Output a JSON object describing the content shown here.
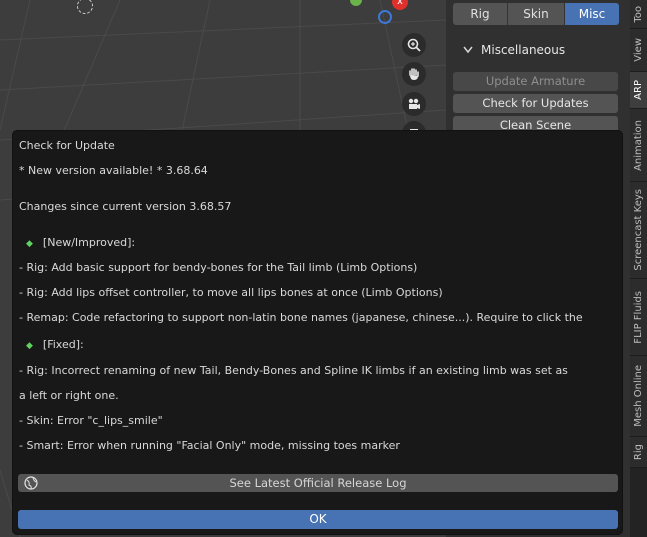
{
  "npanel": {
    "tabs": [
      {
        "label": "Rig",
        "active": false
      },
      {
        "label": "Skin",
        "active": false
      },
      {
        "label": "Misc",
        "active": true
      }
    ],
    "section_title": "Miscellaneous",
    "buttons": {
      "update_armature": "Update Armature",
      "check_updates": "Check for Updates",
      "clean_scene": "Clean Scene"
    }
  },
  "side_tabs": [
    "Too",
    "View",
    "ARP",
    "Animation",
    "Screencast Keys",
    "FLIP Fluids",
    "Mesh Online",
    "Rig"
  ],
  "dialog": {
    "title": "Check for Update",
    "new_version": "* New version available! * 3.68.64",
    "changes": "Changes since current version 3.68.57",
    "section_new": "[New/Improved]:",
    "new_items": [
      "- Rig: Add basic support for bendy-bones for the Tail limb (Limb Options)",
      "- Rig: Add lips offset controller, to move all lips bones at once (Limb Options)",
      "- Remap: Code refactoring to support non-latin bone names (japanese, chinese...). Require to click the"
    ],
    "section_fixed": "[Fixed]:",
    "fixed_items": [
      "- Rig: Incorrect renaming of new Tail, Bendy-Bones and Spline IK limbs if an existing limb was set as",
      "a left or right one.",
      "- Skin: Error \"c_lips_smile\"",
      "- Smart: Error when running \"Facial Only\" mode, missing toes marker"
    ],
    "release_log": "See Latest Official Release Log",
    "ok": "OK"
  },
  "icons": {
    "zoom": "zoom-icon",
    "pan": "hand-icon",
    "camera": "camera-icon",
    "globe": "globe-icon",
    "bullet": "diamond-bullet-icon"
  },
  "colors": {
    "accent": "#4772b3",
    "bullet": "#5fd35f",
    "dialog_bg": "#181818",
    "axis_x": "#e0302c",
    "axis_z": "#3d78d8"
  }
}
